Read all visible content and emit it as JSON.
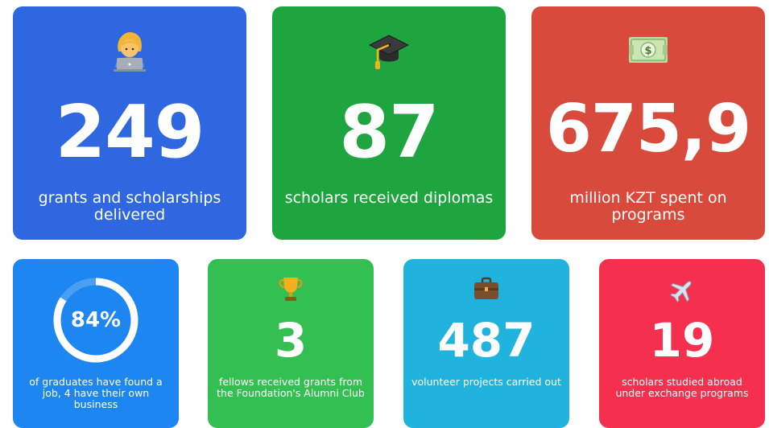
{
  "colors": {
    "card1": "#2f67e0",
    "card2": "#1fa540",
    "card3": "#d84a3c",
    "card4": "#1e86f0",
    "card5": "#34bf52",
    "card6": "#1fb3de",
    "card7": "#f5304f"
  },
  "top": [
    {
      "icon": "technologist-icon",
      "value": "249",
      "label": "grants and scholarships delivered"
    },
    {
      "icon": "graduation-cap-icon",
      "value": "87",
      "label": "scholars received diplomas"
    },
    {
      "icon": "money-banknote-icon",
      "value": "675,9",
      "label": "million KZT spent on programs"
    }
  ],
  "bottom": [
    {
      "icon": "progress-ring",
      "value": "84%",
      "progress": 0.84,
      "label": "of graduates have found a job, 4 have their own business"
    },
    {
      "icon": "trophy-icon",
      "value": "3",
      "label": "fellows received grants from the Foundation's Alumni Club"
    },
    {
      "icon": "briefcase-icon",
      "value": "487",
      "label": "volunteer projects carried out"
    },
    {
      "icon": "airplane-icon",
      "value": "19",
      "label": "scholars studied abroad under exchange programs"
    }
  ]
}
